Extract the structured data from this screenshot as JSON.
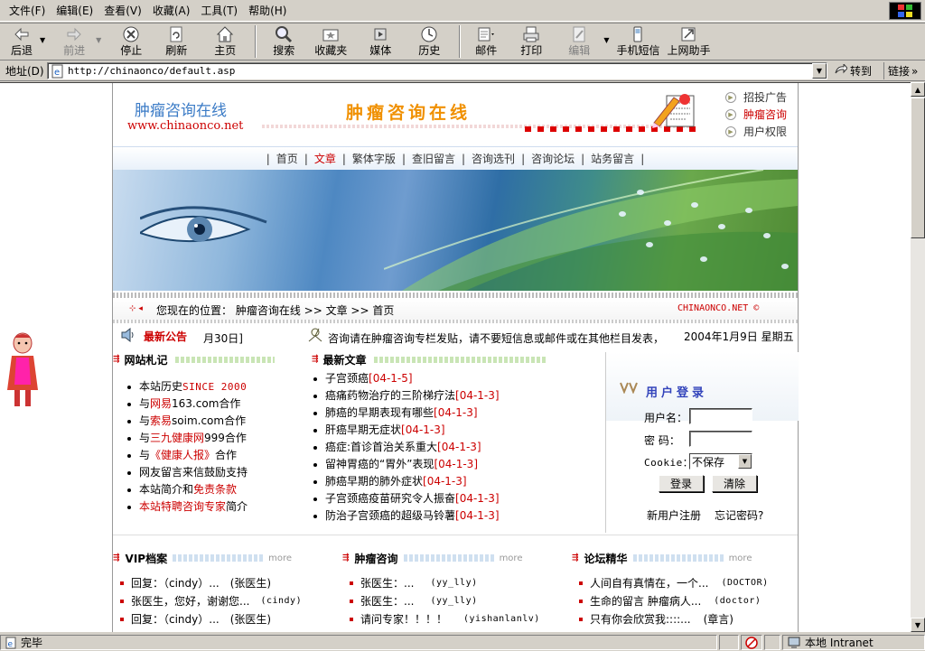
{
  "menu": [
    "文件(F)",
    "编辑(E)",
    "查看(V)",
    "收藏(A)",
    "工具(T)",
    "帮助(H)"
  ],
  "toolbar": {
    "back": "后退",
    "forward": "前进",
    "stop": "停止",
    "refresh": "刷新",
    "home": "主页",
    "search": "搜索",
    "favorites": "收藏夹",
    "media": "媒体",
    "history": "历史",
    "mail": "邮件",
    "print": "打印",
    "edit": "编辑",
    "sms": "手机短信",
    "helper": "上网助手"
  },
  "address": {
    "label": "地址(D)",
    "url": "http://chinaonco/default.asp",
    "go": "转到",
    "links": "链接"
  },
  "status": {
    "text": "完毕",
    "zone": "本地 Intranet"
  },
  "site": {
    "logo_cn": "肿瘤咨询在线",
    "logo_url": "www.chinaonco.net",
    "banner_title": "肿瘤咨询在线",
    "right_links": [
      "招投广告",
      "肿瘤咨询",
      "用户权限"
    ],
    "nav": [
      "首页",
      "文章",
      "繁体字版",
      "查旧留言",
      "咨询选刊",
      "咨询论坛",
      "站务留言"
    ],
    "breadcrumb_label": "您现在的位置：",
    "breadcrumb": "肿瘤咨询在线 >> 文章 >> 首页",
    "site_id": "CHINAONCO.NET ©",
    "announce_title": "最新公告",
    "announce_tail": "月30日]",
    "announce_msg": "咨询请在肿瘤咨询专栏发贴，请不要短信息或邮件或在其他栏目发表，",
    "today": "2004年1月9日 星期五"
  },
  "notes": {
    "title": "网站札记",
    "items": [
      {
        "a": "本站历史 ",
        "b": "SINCE 2000",
        "c": ""
      },
      {
        "a": "与",
        "b": "网易",
        "c": " 163.com合作"
      },
      {
        "a": "与",
        "b": "索易",
        "c": " soim.com合作"
      },
      {
        "a": "与",
        "b": "三九健康网",
        "c": " 999合作"
      },
      {
        "a": "与",
        "b": "《健康人报》",
        "c": "合作"
      },
      {
        "a": "网友留言来信鼓励支持",
        "b": "",
        "c": ""
      },
      {
        "a": "本站简介和",
        "b": "免责条款",
        "c": ""
      },
      {
        "a": "",
        "b": "本站特聘咨询专家",
        "c": "简介"
      }
    ]
  },
  "articles": {
    "title": "最新文章",
    "items": [
      {
        "t": "子宫颈癌",
        "d": "[04-1-5]"
      },
      {
        "t": "癌痛药物治疗的三阶梯疗法",
        "d": "[04-1-3]"
      },
      {
        "t": "肺癌的早期表现有哪些",
        "d": "[04-1-3]"
      },
      {
        "t": "肝癌早期无症状",
        "d": "[04-1-3]"
      },
      {
        "t": "癌症:首诊首治关系重大",
        "d": "[04-1-3]"
      },
      {
        "t": "留神胃癌的“胃外”表现",
        "d": "[04-1-3]"
      },
      {
        "t": "肺癌早期的肺外症状",
        "d": "[04-1-3]"
      },
      {
        "t": "子宫颈癌疫苗研究令人振奋",
        "d": "[04-1-3]"
      },
      {
        "t": "防治子宫颈癌的超级马铃薯",
        "d": "[04-1-3]"
      }
    ]
  },
  "login": {
    "title": "用户登录",
    "user_label": "用户名：",
    "pass_label": "密  码：",
    "cookie_label": "Cookie：",
    "cookie_value": "不保存",
    "login_btn": "登录",
    "clear_btn": "清除",
    "register": "新用户注册",
    "forgot": "忘记密码?"
  },
  "vip": {
    "title": "VIP档案",
    "more": "more",
    "items": [
      {
        "t": "回复：（cindy）...",
        "u": "(张医生)"
      },
      {
        "t": "张医生，您好，谢谢您...",
        "u": "(cindy)"
      },
      {
        "t": "回复：（cindy）...",
        "u": "(张医生)"
      }
    ]
  },
  "consult": {
    "title": "肿瘤咨询",
    "more": "more",
    "items": [
      {
        "t": "张医生：...",
        "u": "(yy_lly)"
      },
      {
        "t": "张医生：...",
        "u": "(yy_lly)"
      },
      {
        "t": "请问专家！！！！",
        "u": "(yishanlanlv)"
      }
    ]
  },
  "forum": {
    "title": "论坛精华",
    "more": "more",
    "items": [
      {
        "t": "人间自有真情在，一个...",
        "u": "(DOCTOR)"
      },
      {
        "t": "生命的留言 肿瘤病人...",
        "u": "(doctor)"
      },
      {
        "t": "只有你会欣赏我::::...",
        "u": "(章言)"
      }
    ]
  }
}
